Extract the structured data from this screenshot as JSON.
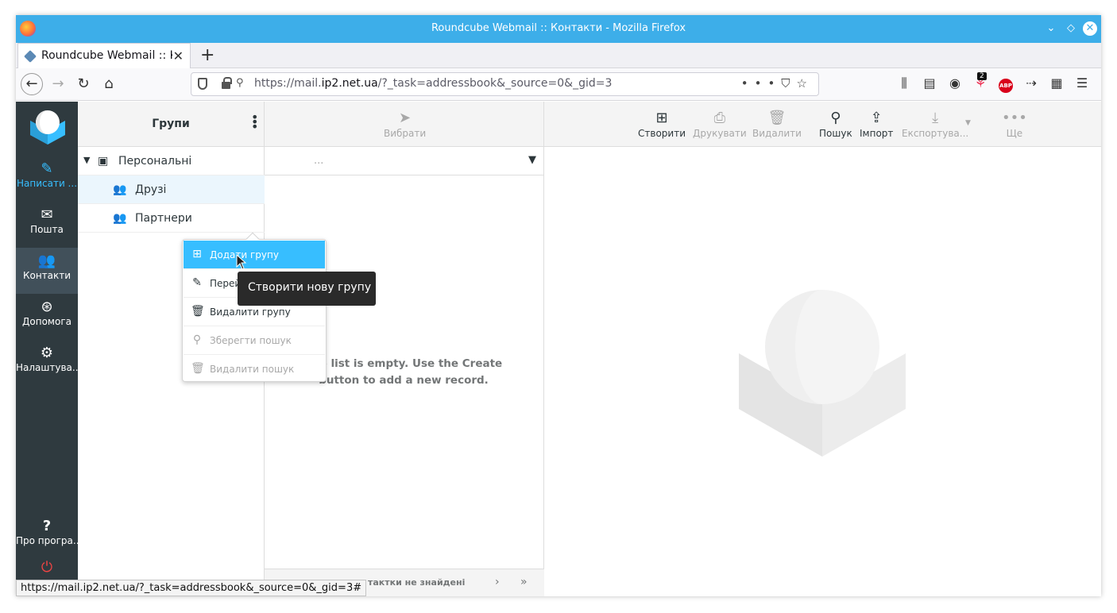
{
  "window": {
    "title": "Roundcube Webmail :: Контакти - Mozilla Firefox"
  },
  "tab": {
    "label": "Roundcube Webmail :: К",
    "close": "✕",
    "new": "+"
  },
  "url": {
    "prefix": "https://mail.",
    "domain": "ip2.net.ua",
    "path": "/?_task=addressbook&_source=0&_gid=3"
  },
  "toolbar_badge": "2",
  "abp_label": "ABP",
  "nav": {
    "compose": "Написати ...",
    "mail": "Пошта",
    "contacts": "Контакти",
    "help": "Допомога",
    "settings": "Налаштува...",
    "about": "Про програ..."
  },
  "groups": {
    "header": "Групи",
    "items": [
      {
        "label": "Персональні"
      },
      {
        "label": "Друзі"
      },
      {
        "label": "Партнери"
      }
    ]
  },
  "list": {
    "select_label": "Вибрати",
    "search_placeholder": "...",
    "empty_message": "The list is empty. Use the Create button to add a new record.",
    "count": "Контакти не знайдені",
    "count_visible": "тактки не знайдені"
  },
  "detail_toolbar": {
    "create": "Створити",
    "print": "Друкувати",
    "delete": "Видалити",
    "search": "Пошук",
    "import": "Імпорт",
    "export": "Експортува...",
    "more": "Ще"
  },
  "group_menu": {
    "items": [
      {
        "label": "Додати групу"
      },
      {
        "label": "Перейменувати групу"
      },
      {
        "label": "Видалити групу"
      },
      {
        "label": "Зберегти пошук"
      },
      {
        "label": "Видалити пошук"
      }
    ]
  },
  "tooltip": "Створити нову групу",
  "status_url": "https://mail.ip2.net.ua/?_task=addressbook&_source=0&_gid=3#",
  "colors": {
    "titlebar": "#3daee9",
    "accent": "#37beff",
    "nav_bg": "#2f3a3f",
    "nav_active": "#41505a"
  }
}
